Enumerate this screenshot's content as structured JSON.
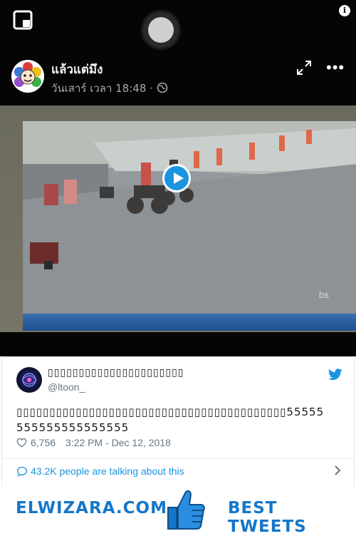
{
  "post": {
    "author": "แล้วแต่มึง",
    "meta": "วันเสาร์ เวลา 18:48 ·",
    "watermark": "bs"
  },
  "icons": {
    "pip": "pip-icon",
    "record": "record-button",
    "info": "info-icon",
    "expand": "expand-icon",
    "more": "more-icon",
    "play": "play-icon",
    "twitter": "twitter-bird-icon",
    "heart": "heart-icon",
    "comment": "comment-bubble-icon",
    "chevron": "chevron-right-icon",
    "thumb": "thumbs-up-icon"
  },
  "tweet": {
    "name": "▯▯▯▯▯▯▯▯▯▯▯▯▯▯▯▯▯▯▯▯▯▯",
    "handle": "@ltoon_",
    "text": "▯▯▯▯▯▯▯▯▯▯▯▯▯▯▯▯▯▯▯▯▯▯▯▯▯▯▯▯▯▯▯▯▯▯▯▯▯▯▯▯▯55555555555555555555",
    "likes": "6,756",
    "timestamp": "3:22 PM - Dec 12, 2018",
    "talking": "43.2K people are talking about this"
  },
  "banner": {
    "left": "ELWIZARA.COM",
    "right": "BEST TWEETS"
  },
  "colors": {
    "twitter_blue": "#1b95e0",
    "brand_blue": "#1577c9"
  }
}
